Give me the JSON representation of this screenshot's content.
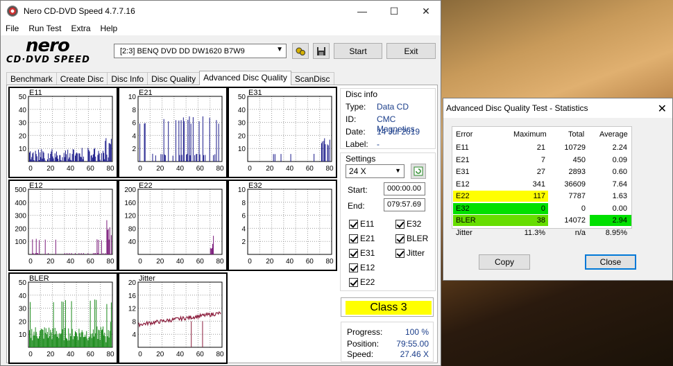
{
  "window": {
    "title": "Nero CD-DVD Speed 4.7.7.16"
  },
  "menu": [
    "File",
    "Run Test",
    "Extra",
    "Help"
  ],
  "logo": {
    "line1": "nero",
    "line2": "CD·DVD SPEED"
  },
  "drive": {
    "selected": "[2:3]   BENQ DVD DD DW1620 B7W9"
  },
  "toolbar": {
    "start": "Start",
    "exit": "Exit"
  },
  "tabs": [
    "Benchmark",
    "Create Disc",
    "Disc Info",
    "Disc Quality",
    "Advanced Disc Quality",
    "ScanDisc"
  ],
  "disc_info": {
    "header": "Disc info",
    "type_label": "Type:",
    "type": "Data CD",
    "id_label": "ID:",
    "id": "CMC Magnetics",
    "date_label": "Date:",
    "date": "14 Jul 2019",
    "label_label": "Label:",
    "label": "-"
  },
  "settings": {
    "header": "Settings",
    "speed": "24 X",
    "start_label": "Start:",
    "start": "000:00.00",
    "end_label": "End:",
    "end": "079:57.69",
    "checks": [
      "E11",
      "E32",
      "E21",
      "BLER",
      "E31",
      "Jitter",
      "E12",
      "E22"
    ]
  },
  "class": "Class 3",
  "progress": {
    "progress_label": "Progress:",
    "progress": "100 %",
    "position_label": "Position:",
    "position": "79:55.00",
    "speed_label": "Speed:",
    "speed": "27.46 X"
  },
  "chart_data": [
    {
      "type": "bar",
      "title": "E11",
      "x_ticks": [
        "0",
        "20",
        "40",
        "60",
        "80"
      ],
      "y_ticks": [
        "50",
        "40",
        "30",
        "20",
        "10"
      ],
      "ylim": [
        0,
        50
      ],
      "color": "#1a1a8a"
    },
    {
      "type": "bar",
      "title": "E21",
      "x_ticks": [
        "0",
        "20",
        "40",
        "60",
        "80"
      ],
      "y_ticks": [
        "10",
        "8",
        "6",
        "4",
        "2"
      ],
      "ylim": [
        0,
        10
      ],
      "color": "#1a1a8a"
    },
    {
      "type": "bar",
      "title": "E31",
      "x_ticks": [
        "0",
        "20",
        "40",
        "60",
        "80"
      ],
      "y_ticks": [
        "50",
        "40",
        "30",
        "20",
        "10"
      ],
      "ylim": [
        0,
        50
      ],
      "color": "#1a1a8a"
    },
    {
      "type": "bar",
      "title": "E12",
      "x_ticks": [
        "0",
        "20",
        "40",
        "60",
        "80"
      ],
      "y_ticks": [
        "500",
        "400",
        "300",
        "200",
        "100"
      ],
      "ylim": [
        0,
        500
      ],
      "color": "#7a1a7a"
    },
    {
      "type": "bar",
      "title": "E22",
      "x_ticks": [
        "0",
        "20",
        "40",
        "60",
        "80"
      ],
      "y_ticks": [
        "200",
        "160",
        "120",
        "80",
        "40"
      ],
      "ylim": [
        0,
        200
      ],
      "color": "#7a1a7a"
    },
    {
      "type": "bar",
      "title": "E32",
      "x_ticks": [
        "0",
        "20",
        "40",
        "60",
        "80"
      ],
      "y_ticks": [
        "10",
        "8",
        "6",
        "4",
        "2"
      ],
      "ylim": [
        0,
        10
      ],
      "color": "#7a1a7a"
    },
    {
      "type": "bar",
      "title": "BLER",
      "x_ticks": [
        "0",
        "20",
        "40",
        "60",
        "80"
      ],
      "y_ticks": [
        "50",
        "40",
        "30",
        "20",
        "10"
      ],
      "ylim": [
        0,
        50
      ],
      "color": "#1a8a1a"
    },
    {
      "type": "line",
      "title": "Jitter",
      "x_ticks": [
        "0",
        "20",
        "40",
        "60",
        "80"
      ],
      "y_ticks": [
        "20",
        "16",
        "12",
        "8",
        "4"
      ],
      "ylim": [
        0,
        20
      ],
      "color": "#8a1a3a"
    }
  ],
  "stats_dialog": {
    "title": "Advanced Disc Quality Test - Statistics",
    "headers": [
      "Error",
      "Maximum",
      "Total",
      "Average"
    ],
    "rows": [
      {
        "name": "E11",
        "max": "21",
        "total": "10729",
        "avg": "2.24"
      },
      {
        "name": "E21",
        "max": "7",
        "total": "450",
        "avg": "0.09"
      },
      {
        "name": "E31",
        "max": "27",
        "total": "2893",
        "avg": "0.60"
      },
      {
        "name": "E12",
        "max": "341",
        "total": "36609",
        "avg": "7.64"
      },
      {
        "name": "E22",
        "max": "117",
        "total": "7787",
        "avg": "1.63"
      },
      {
        "name": "E32",
        "max": "0",
        "total": "0",
        "avg": "0.00"
      },
      {
        "name": "BLER",
        "max": "38",
        "total": "14072",
        "avg": "2.94"
      },
      {
        "name": "Jitter",
        "max": "11.3%",
        "total": "n/a",
        "avg": "8.95%"
      }
    ],
    "copy": "Copy",
    "close": "Close"
  },
  "colors": {
    "yellow": "#ffff00",
    "green": "#00e000",
    "lime": "#66dd00"
  }
}
